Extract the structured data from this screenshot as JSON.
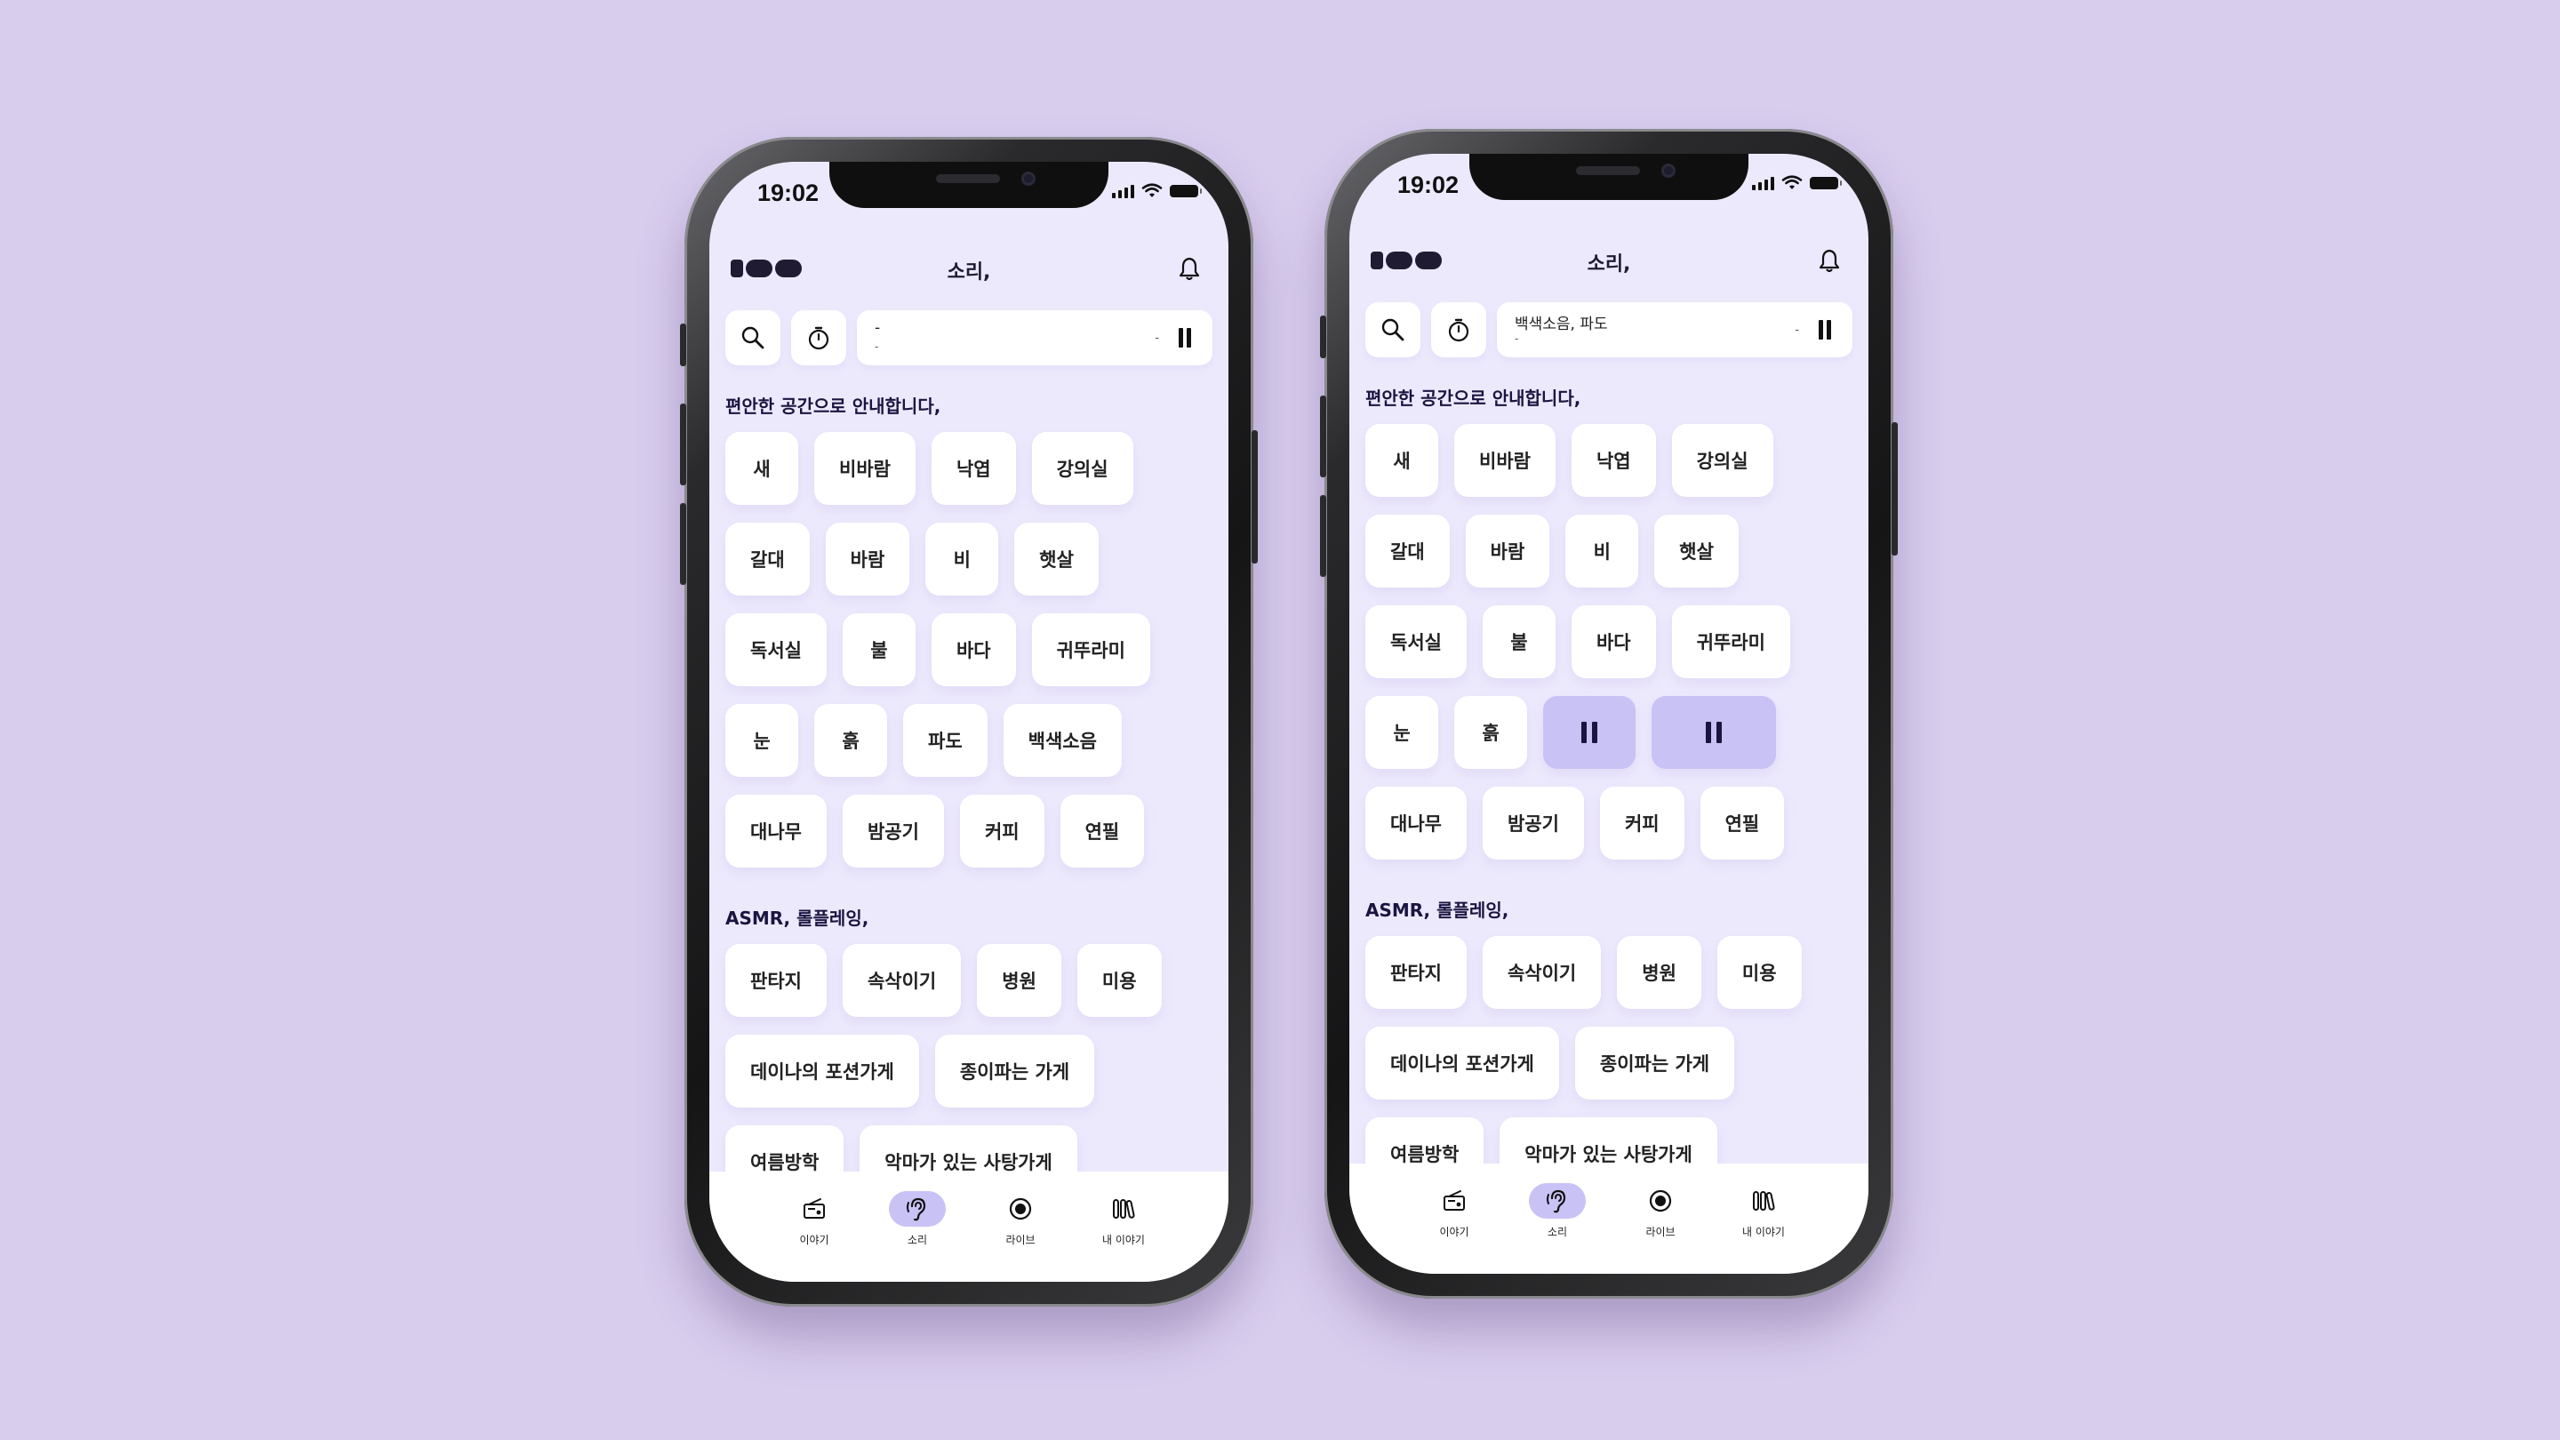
{
  "colors": {
    "background": "#d9cdee",
    "screen": "#ede9fd",
    "accent": "#c9c2f5",
    "text": "#1e1b33"
  },
  "status": {
    "time": "19:02"
  },
  "header": {
    "title": "소리,"
  },
  "player_left": {
    "line1": "-",
    "line2": "-",
    "dash": "-"
  },
  "player_right": {
    "line1": "백색소음, 파도",
    "line2": "-",
    "dash": "-"
  },
  "section1": {
    "title": "편안한 공간으로 안내합니다,"
  },
  "section2": {
    "title": "ASMR, 롤플레잉,"
  },
  "sounds": {
    "r1": [
      "새",
      "비바람",
      "낙엽",
      "강의실"
    ],
    "r2": [
      "갈대",
      "바람",
      "비",
      "햇살"
    ],
    "r3": [
      "독서실",
      "불",
      "바다",
      "귀뚜라미"
    ],
    "r4": [
      "눈",
      "흙",
      "파도",
      "백색소음"
    ],
    "r5": [
      "대나무",
      "밤공기",
      "커피",
      "연필"
    ]
  },
  "asmr": {
    "r1": [
      "판타지",
      "속삭이기",
      "병원",
      "미용"
    ],
    "r2": [
      "데이나의 포션가게",
      "종이파는 가게"
    ],
    "r3": [
      "여름방학",
      "악마가 있는 사탕가게"
    ]
  },
  "tabs": [
    "이야기",
    "소리",
    "라이브",
    "내 이야기"
  ],
  "icons": [
    "logo-icon",
    "bell-icon",
    "search-icon",
    "timer-icon",
    "pause-icon",
    "radio-icon",
    "ear-icon",
    "record-icon",
    "library-icon"
  ]
}
